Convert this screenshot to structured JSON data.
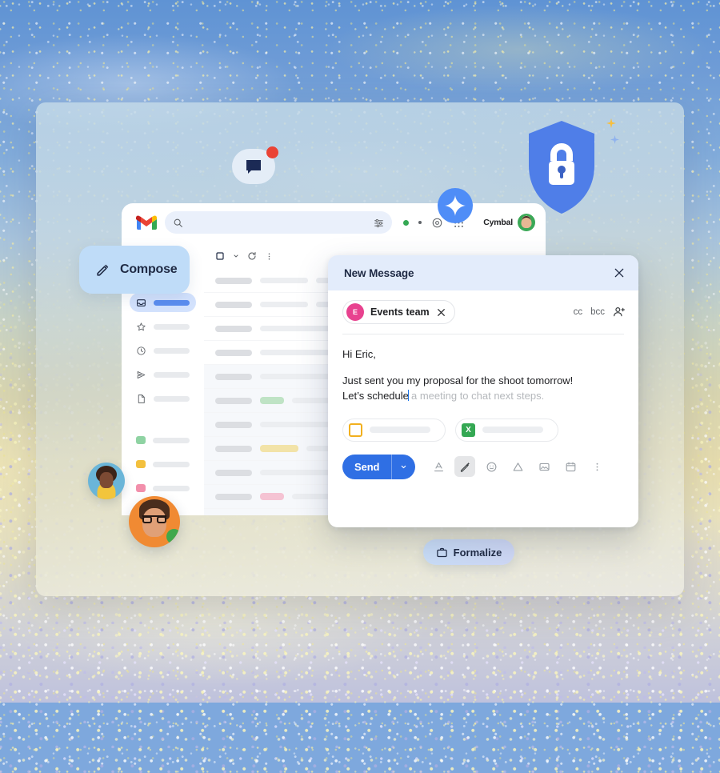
{
  "app": {
    "name": "Gmail",
    "brand_label": "Cymbal",
    "logo_icon": "gmail-logo-icon",
    "search_placeholder": "",
    "search_icon": "search-icon",
    "filter_icon": "tune-filter-icon",
    "settings_icon": "gear-icon",
    "apps_icon": "apps-grid-icon",
    "status_dot_color": "#34a853"
  },
  "sidebar": {
    "compose_label": "Compose",
    "compose_icon": "pencil-icon",
    "items": [
      {
        "icon": "inbox-icon",
        "label": "",
        "selected": true
      },
      {
        "icon": "star-icon",
        "label": "",
        "selected": false
      },
      {
        "icon": "clock-snoozed-icon",
        "label": "",
        "selected": false
      },
      {
        "icon": "send-paperplane-icon",
        "label": "",
        "selected": false
      },
      {
        "icon": "draft-file-icon",
        "label": "",
        "selected": false
      }
    ],
    "labels": [
      {
        "icon": "label-tag-icon",
        "color": "#8fd3a3"
      },
      {
        "icon": "label-tag-icon",
        "color": "#f3c03d"
      },
      {
        "icon": "label-tag-icon",
        "color": "#f28fab"
      }
    ]
  },
  "list": {
    "select_all_icon": "checkbox-icon",
    "select_dropdown_icon": "chevron-down-icon",
    "refresh_icon": "refresh-icon",
    "more_icon": "more-vertical-icon",
    "rows": [
      {
        "state": "unread",
        "chip": ""
      },
      {
        "state": "unread",
        "chip": ""
      },
      {
        "state": "unread",
        "chip": ""
      },
      {
        "state": "unread",
        "chip": ""
      },
      {
        "state": "read",
        "chip": ""
      },
      {
        "state": "read",
        "chip": "#bfe3c5"
      },
      {
        "state": "read",
        "chip": ""
      },
      {
        "state": "read",
        "chip": "#f2e3a8"
      },
      {
        "state": "read",
        "chip": ""
      },
      {
        "state": "read",
        "chip": "#f5c3d3"
      },
      {
        "state": "read",
        "chip": ""
      }
    ]
  },
  "compose": {
    "title": "New Message",
    "close_icon": "close-icon",
    "recipient": {
      "avatar_initial": "E",
      "avatar_color": "#e8428f",
      "name": "Events team",
      "remove_icon": "close-icon"
    },
    "cc_label": "cc",
    "bcc_label": "bcc",
    "add_recipient_icon": "add-person-icon",
    "body": {
      "greeting": "Hi Eric,",
      "typed_line_1": "Just sent you my proposal for the shoot tomorrow!",
      "typed_line_2": "Let’s schedule",
      "suggestion": " a meeting to chat next steps."
    },
    "attachments": [
      {
        "icon": "slides-icon",
        "color": "#f2b01e",
        "name": ""
      },
      {
        "icon": "sheets-icon",
        "color": "#34a853",
        "letter": "X",
        "name": ""
      }
    ],
    "toolbar": {
      "send_label": "Send",
      "send_dropdown_icon": "chevron-down-icon",
      "buttons": [
        {
          "icon": "format-text-icon",
          "active": false
        },
        {
          "icon": "magic-pen-icon",
          "active": true
        },
        {
          "icon": "emoji-icon",
          "active": false
        },
        {
          "icon": "drive-icon",
          "active": false
        },
        {
          "icon": "insert-image-icon",
          "active": false
        },
        {
          "icon": "calendar-icon",
          "active": false
        },
        {
          "icon": "more-vertical-icon",
          "active": false
        }
      ]
    }
  },
  "floating": {
    "chat_icon": "chat-bubble-icon",
    "chat_badge_color": "#ea4335",
    "gemini_icon": "gemini-sparkle-icon",
    "gemini_color": "#4f8df7",
    "shield_icon": "shield-lock-icon",
    "shield_color": "#4f7ee8",
    "sparkle_yellow_icon": "sparkle-icon",
    "sparkle_blue_icon": "sparkle-icon",
    "formalize_label": "Formalize",
    "formalize_icon": "briefcase-icon",
    "avatar_small": "avatar",
    "avatar_large": "avatar",
    "presence_color": "#3fa84c"
  }
}
